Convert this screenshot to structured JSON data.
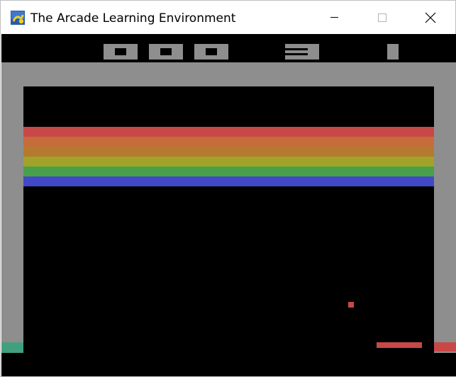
{
  "window": {
    "title": "The Arcade Learning Environment",
    "icon": "pygame-snake-icon",
    "controls": {
      "minimize": "minimize-icon",
      "maximize": "maximize-icon",
      "close": "close-icon"
    }
  },
  "game": {
    "name": "Breakout",
    "hud": {
      "score": "000",
      "lives": "3",
      "player": "1"
    },
    "brick_rows": [
      {
        "color": "#c84848"
      },
      {
        "color": "#c66c3a"
      },
      {
        "color": "#b47a30"
      },
      {
        "color": "#a2a22a"
      },
      {
        "color": "#48a048"
      },
      {
        "color": "#4248c8"
      }
    ],
    "colors": {
      "background": "#000000",
      "wall": "#8e8e8e",
      "ball": "#c84848",
      "paddle": "#c84848",
      "left_base": "#42a07e",
      "right_base": "#c84848"
    }
  }
}
